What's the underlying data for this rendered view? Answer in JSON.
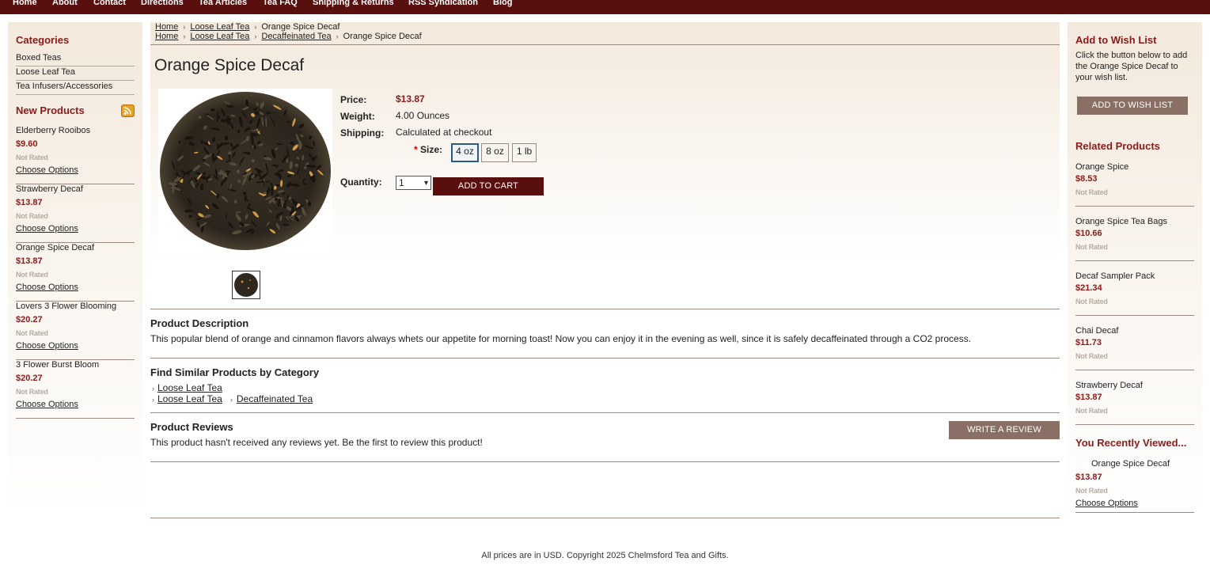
{
  "nav": {
    "items": [
      "Home",
      "About",
      "Contact",
      "Directions",
      "Tea Articles",
      "Tea FAQ",
      "Shipping & Returns",
      "RSS Syndication",
      "Blog"
    ]
  },
  "sidebar": {
    "categories_heading": "Categories",
    "categories": [
      "Boxed Teas",
      "Loose Leaf Tea",
      "Tea Infusers/Accessories"
    ],
    "new_products_heading": "New Products",
    "new_products": [
      {
        "name": "Elderberry Rooibos",
        "price": "$9.60",
        "rating": "Not Rated",
        "action": "Choose Options"
      },
      {
        "name": "Strawberry Decaf",
        "price": "$13.87",
        "rating": "Not Rated",
        "action": "Choose Options"
      },
      {
        "name": "Orange Spice Decaf",
        "price": "$13.87",
        "rating": "Not Rated",
        "action": "Choose Options"
      },
      {
        "name": "Lovers 3 Flower Blooming",
        "price": "$20.27",
        "rating": "Not Rated",
        "action": "Choose Options"
      },
      {
        "name": "3 Flower Burst Bloom",
        "price": "$20.27",
        "rating": "Not Rated",
        "action": "Choose Options"
      }
    ]
  },
  "breadcrumbs": [
    {
      "home": "Home",
      "cat": "Loose Leaf Tea",
      "current": "Orange Spice Decaf"
    },
    {
      "home": "Home",
      "cat": "Loose Leaf Tea",
      "sub": "Decaffeinated Tea",
      "current": "Orange Spice Decaf"
    }
  ],
  "product": {
    "title": "Orange Spice Decaf",
    "price_label": "Price:",
    "price": "$13.87",
    "weight_label": "Weight:",
    "weight": "4.00 Ounces",
    "shipping_label": "Shipping:",
    "shipping": "Calculated at checkout",
    "size_required": "*",
    "size_label": "Size:",
    "sizes": [
      "4 oz",
      "8 oz",
      "1 lb"
    ],
    "selected_size": "4 oz",
    "quantity_label": "Quantity:",
    "quantity": "1",
    "add_to_cart": "ADD TO CART"
  },
  "description": {
    "heading": "Product Description",
    "text": "This popular blend of orange and cinnamon flavors always whets our appetite for morning toast! Now you can enjoy it in the evening as well, since it is safely decaffeinated through a CO2 process."
  },
  "similar": {
    "heading": "Find Similar Products by Category",
    "row1": "Loose Leaf Tea",
    "row2_a": "Loose Leaf Tea",
    "row2_b": "Decaffeinated Tea"
  },
  "reviews": {
    "heading": "Product Reviews",
    "text": "This product hasn't received any reviews yet. Be the first to review this product!",
    "write_button": "WRITE A REVIEW"
  },
  "wishlist": {
    "heading": "Add to Wish List",
    "text": "Click the button below to add the Orange Spice Decaf to your wish list.",
    "button": "ADD TO WISH LIST"
  },
  "related": {
    "heading": "Related Products",
    "items": [
      {
        "name": "Orange Spice",
        "price": "$8.53",
        "rating": "Not Rated"
      },
      {
        "name": "Orange Spice Tea Bags",
        "price": "$10.66",
        "rating": "Not Rated"
      },
      {
        "name": "Decaf Sampler Pack",
        "price": "$21.34",
        "rating": "Not Rated"
      },
      {
        "name": "Chai Decaf",
        "price": "$11.73",
        "rating": "Not Rated"
      },
      {
        "name": "Strawberry Decaf",
        "price": "$13.87",
        "rating": "Not Rated"
      }
    ]
  },
  "recently_viewed": {
    "heading": "You Recently Viewed...",
    "item": {
      "name": "Orange Spice Decaf",
      "price": "$13.87",
      "rating": "Not Rated",
      "action": "Choose Options"
    }
  },
  "footer": {
    "text": "All prices are in USD. Copyright 2025 Chelmsford Tea and Gifts."
  },
  "colors": {
    "nav_bg": "#5a0f0f",
    "accent": "#8b1a1a",
    "button_dark": "#5a0f0f",
    "button_muted": "#8a7064"
  },
  "icons": {
    "rss": "rss-feed-icon",
    "breadcrumb_separator": "chevron-right-icon",
    "quantity_dropdown": "chevron-down-icon"
  }
}
